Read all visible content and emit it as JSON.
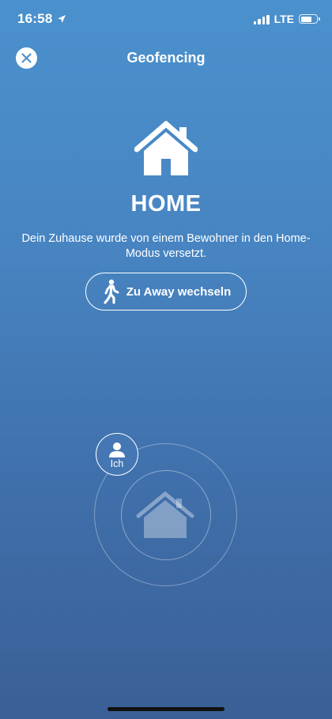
{
  "status_bar": {
    "time": "16:58",
    "network": "LTE",
    "battery_level": 0.7
  },
  "nav": {
    "title": "Geofencing",
    "close_icon": "close-icon"
  },
  "mode": {
    "icon": "house-icon",
    "title": "HOME",
    "description": "Dein Zuhause wurde von einem Bewohner in den Home-Modus versetzt."
  },
  "switch_button": {
    "icon": "walking-person-icon",
    "label": "Zu Away wechseln"
  },
  "geofence": {
    "user_label": "Ich",
    "user_icon": "person-icon",
    "center_icon": "house-icon"
  },
  "colors": {
    "background_top": "#4a91cd",
    "background_bottom": "#3a5f97",
    "foreground": "#ffffff"
  }
}
